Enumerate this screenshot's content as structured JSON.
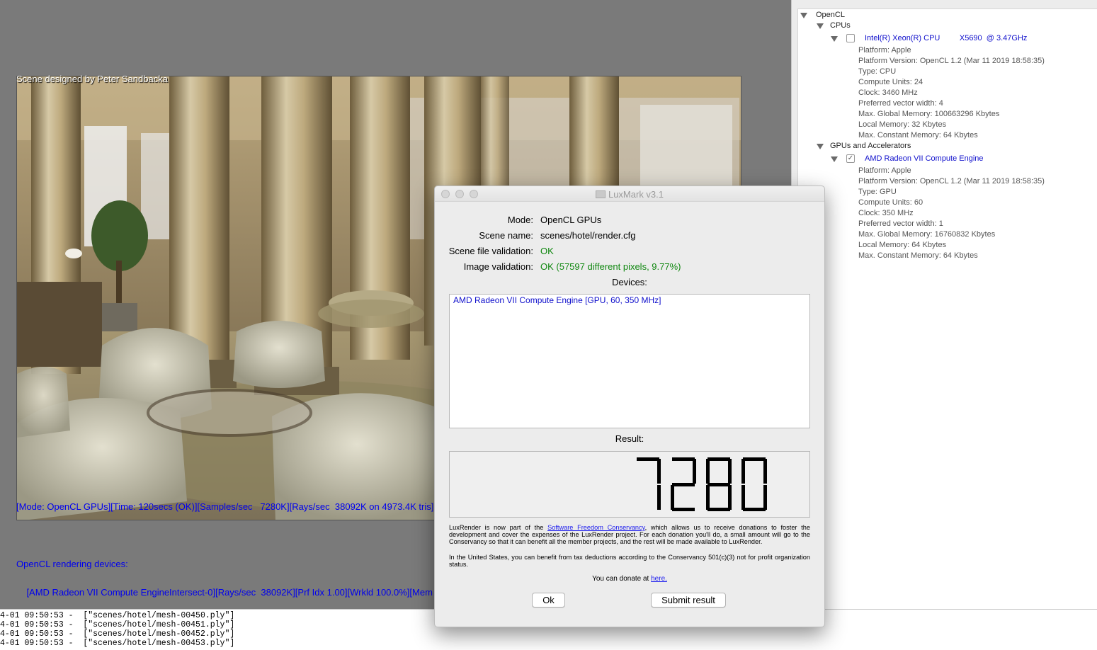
{
  "render": {
    "scene_credit": "Scene designed by Peter Sandbacka",
    "overlay": {
      "line1": "[Mode: OpenCL GPUs][Time: 120secs (OK)][Samples/sec   7280K][Rays/sec  38092K on 4973.4K tris]",
      "line2": "OpenCL rendering devices:",
      "line3": "    [AMD Radeon VII Compute EngineIntersect-0][Rays/sec  38092K][Prf Idx 1.00][Wrkld 100.0%][Mem"
    }
  },
  "device_tree": {
    "root": "OpenCL",
    "cpu_group": "CPUs",
    "cpu_device": {
      "name": "Intel(R) Xeon(R) CPU         X5690  @ 3.47GHz",
      "checked": false,
      "props": [
        "Platform: Apple",
        "Platform Version: OpenCL 1.2 (Mar 11 2019 18:58:35)",
        "Type: CPU",
        "Compute Units: 24",
        "Clock: 3460 MHz",
        "Preferred vector width: 4",
        "Max. Global Memory: 100663296 Kbytes",
        "Local Memory: 32 Kbytes",
        "Max. Constant Memory: 64 Kbytes"
      ]
    },
    "gpu_group": "GPUs and Accelerators",
    "gpu_device": {
      "name": "AMD Radeon VII Compute Engine",
      "checked": true,
      "check_glyph": "✓",
      "props": [
        "Platform: Apple",
        "Platform Version: OpenCL 1.2 (Mar 11 2019 18:58:35)",
        "Type: GPU",
        "Compute Units: 60",
        "Clock: 350 MHz",
        "Preferred vector width: 1",
        "Max. Global Memory: 16760832 Kbytes",
        "Local Memory: 64 Kbytes",
        "Max. Constant Memory: 64 Kbytes"
      ]
    }
  },
  "log": {
    "lines": [
      "4-01 09:50:53 -  [\"scenes/hotel/mesh-00450.ply\"]",
      "4-01 09:50:53 -  [\"scenes/hotel/mesh-00451.ply\"]",
      "4-01 09:50:53 -  [\"scenes/hotel/mesh-00452.ply\"]",
      "4-01 09:50:53 -  [\"scenes/hotel/mesh-00453.ply\"]"
    ]
  },
  "dialog": {
    "title": "LuxMark v3.1",
    "mode_label": "Mode:",
    "mode_value": "OpenCL GPUs",
    "scene_label": "Scene name:",
    "scene_value": "scenes/hotel/render.cfg",
    "validation_label": "Scene file validation:",
    "validation_value": "OK",
    "image_validation_label": "Image validation:",
    "image_validation_value": "OK (57597 different pixels, 9.77%)",
    "devices_label": "Devices:",
    "devices": [
      "AMD Radeon VII Compute Engine [GPU, 60, 350 MHz]"
    ],
    "result_label": "Result:",
    "result_value": "7280",
    "para1_a": "LuxRender is now part of the ",
    "para1_link": "Software Freedom Conservancy",
    "para1_b": ", which allows us to receive donations to foster the development and cover the expenses of the LuxRender project. For each donation you'll do, a small amount will go to the Conservancy so that it can benefit all the member projects, and the rest will be made available to LuxRender.",
    "para2": "In the United States, you can benefit from tax deductions according to the Conservancy 501(c)(3) not for profit organization status.",
    "donate_text": "You can donate at ",
    "donate_link": "here.",
    "ok_button": "Ok",
    "submit_button": "Submit result"
  },
  "colors": {
    "link_blue": "#1010cc",
    "ok_green": "#118811",
    "background_gray": "#7a7a7a"
  }
}
